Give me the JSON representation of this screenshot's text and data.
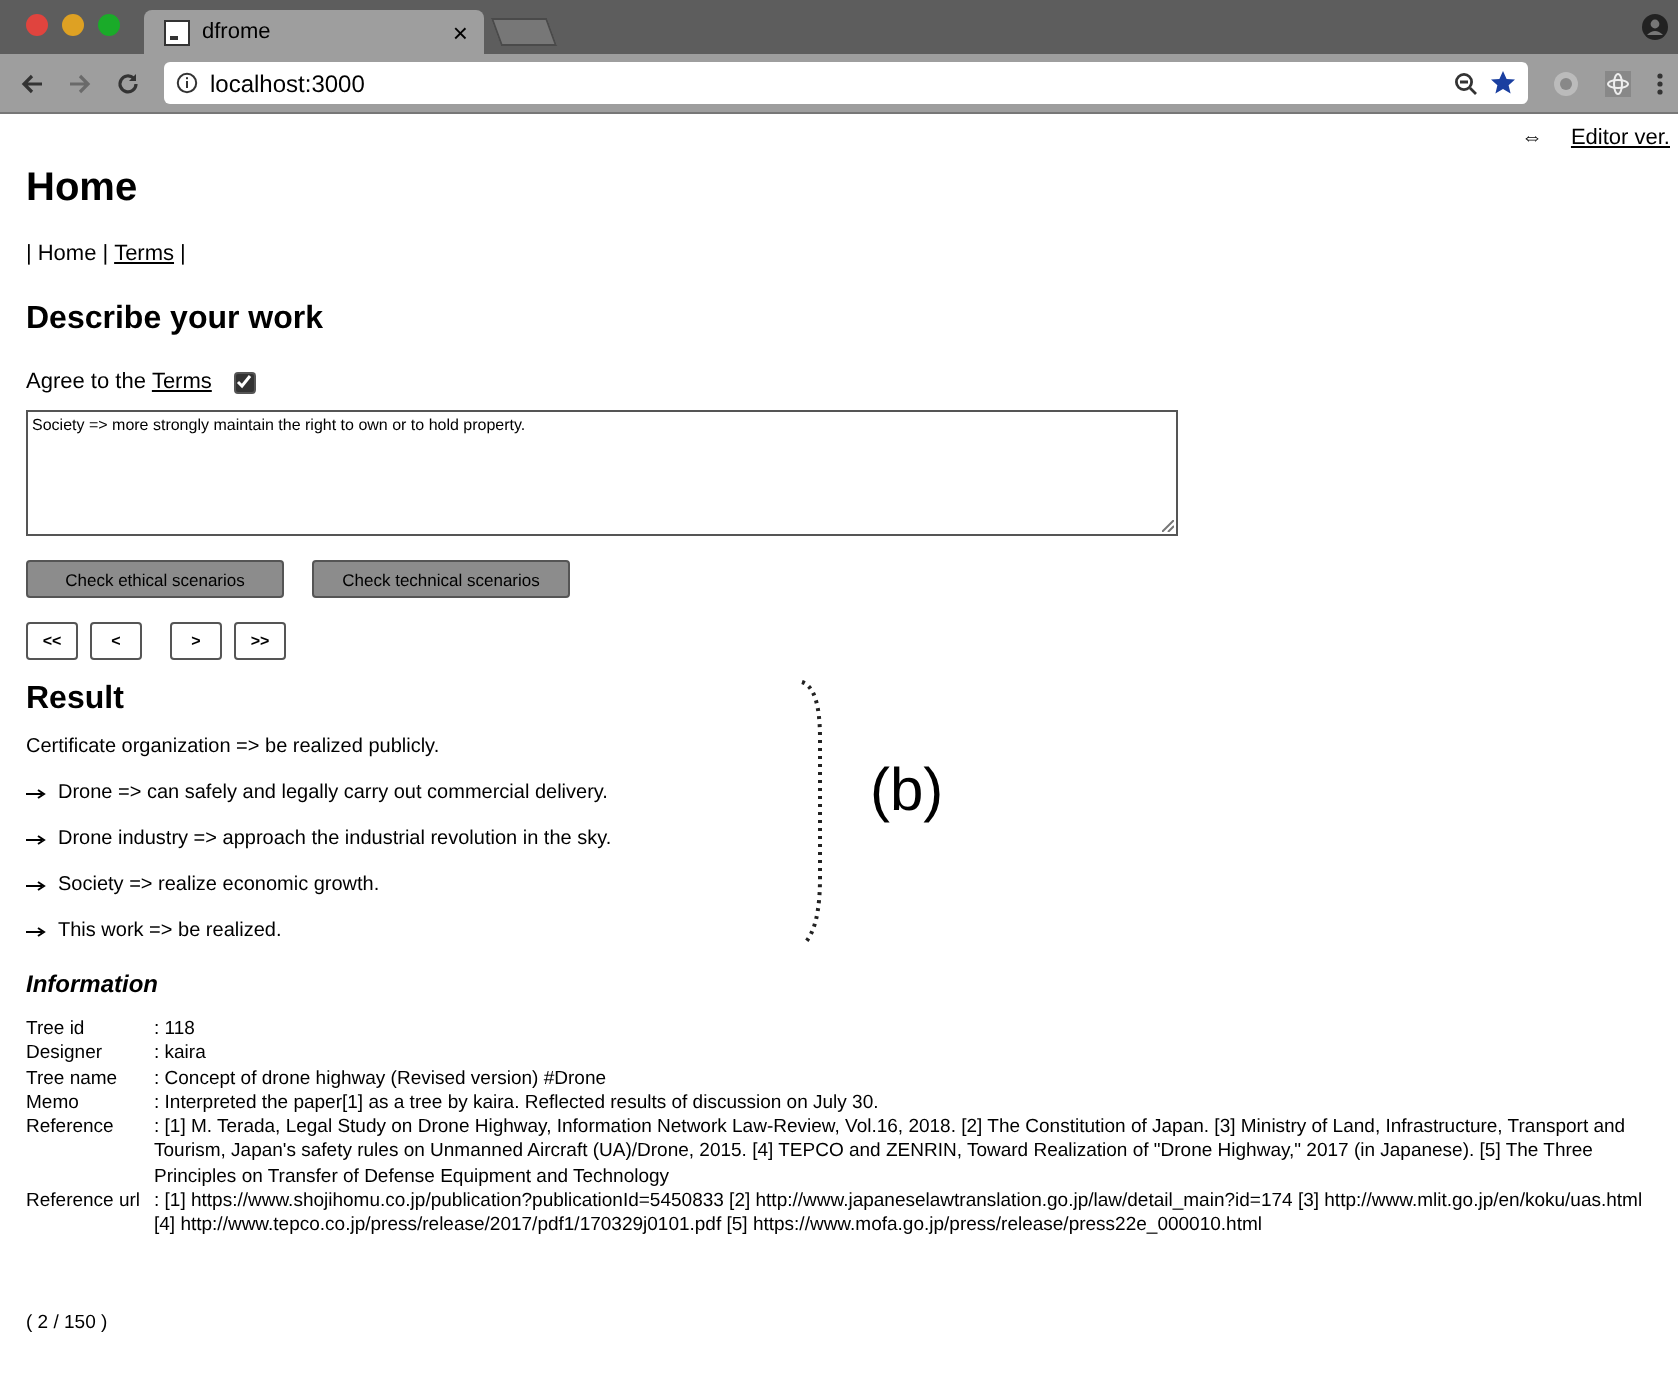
{
  "browser": {
    "tab_title": "dfrome",
    "close": "×",
    "url": "localhost:3000"
  },
  "editor_link": {
    "arrow": "⇔",
    "label": "Editor ver."
  },
  "title": "Home",
  "nav_separator": "|",
  "nav": [
    {
      "label": "Home",
      "link": false
    },
    {
      "label": "Terms",
      "link": true
    }
  ],
  "describe": {
    "heading": "Describe your work",
    "agree_label": "Agree to the",
    "agree_link": "Terms",
    "agree_checked": true,
    "text": "Society => more strongly maintain the right to own or to hold property."
  },
  "buttons": [
    "Check ethical scenarios",
    "Check technical scenarios"
  ],
  "pager": [
    "<<",
    "<",
    ">",
    ">>"
  ],
  "result": {
    "heading": "Result",
    "items": [
      {
        "arrow": false,
        "text": "Certificate organization => be realized publicly."
      },
      {
        "arrow": true,
        "text": "Drone => can safely and legally carry out commercial delivery."
      },
      {
        "arrow": true,
        "text": "Drone industry => approach the industrial revolution in the sky."
      },
      {
        "arrow": true,
        "text": "Society => realize economic growth."
      },
      {
        "arrow": true,
        "text": "This work => be realized."
      }
    ],
    "annotation": "(b)"
  },
  "information": {
    "heading": "Information",
    "rows": [
      {
        "label": "Tree id",
        "value": ": 118"
      },
      {
        "label": "Designer",
        "value": ": kaira"
      },
      {
        "label": "Tree name",
        "value": ": Concept of drone highway (Revised version) #Drone"
      },
      {
        "label": "Memo",
        "value": ": Interpreted the paper[1] as a tree by kaira. Reflected results of discussion on July 30."
      },
      {
        "label": "Reference",
        "value": ": [1] M. Terada, Legal Study on Drone Highway, Information Network Law-Review, Vol.16, 2018. [2] The Constitution of Japan. [3] Ministry of Land, Infrastructure, Transport and Tourism, Japan's safety rules on Unmanned Aircraft (UA)/Drone, 2015. [4] TEPCO and ZENRIN, Toward Realization of \"Drone Highway,\" 2017 (in Japanese). [5] The Three Principles on Transfer of Defense Equipment and Technology"
      },
      {
        "label": "Reference url",
        "value": ": [1] https://www.shojihomu.co.jp/publication?publicationId=5450833 [2] http://www.japaneselawtranslation.go.jp/law/detail_main?id=174 [3] http://www.mlit.go.jp/en/koku/uas.html [4] http://www.tepco.co.jp/press/release/2017/pdf1/170329j0101.pdf [5] https://www.mofa.go.jp/press/release/press22e_000010.html"
      }
    ]
  },
  "page_count": "( 2 / 150 )"
}
